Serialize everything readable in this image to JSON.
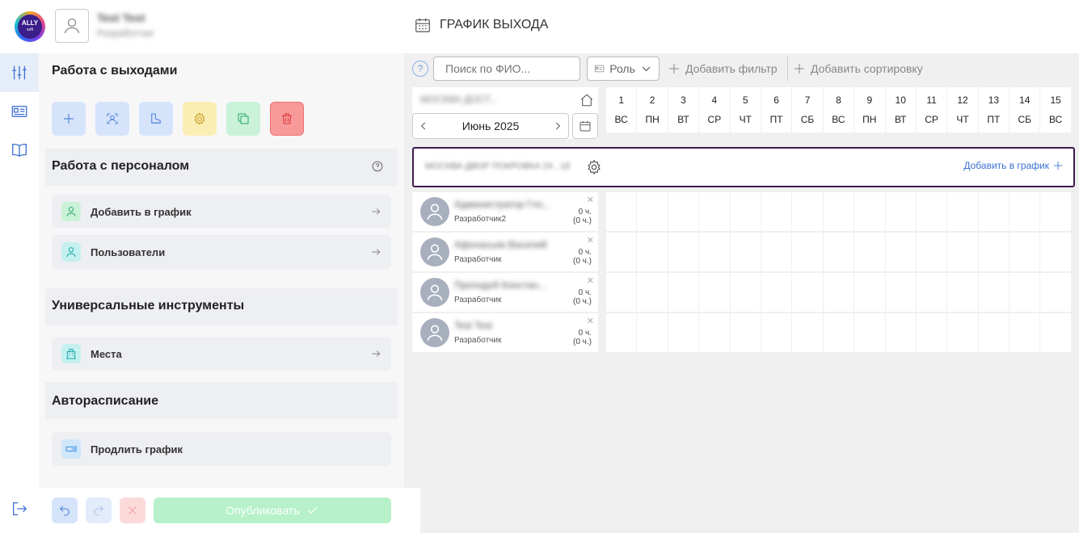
{
  "header": {
    "logo_text": "ALLY",
    "logo_sub": "soft",
    "user_name": "Test Test",
    "user_role": "Разработчик",
    "page_title": "ГРАФИК ВЫХОДА"
  },
  "panel": {
    "sections": {
      "exits": "Работа с выходами",
      "staff": "Работа с персоналом",
      "tools": "Универсальные инструменты",
      "auto": "Авторасписание"
    },
    "cards": {
      "add_to_schedule": "Добавить в график",
      "users": "Пользователи",
      "places": "Места",
      "extend": "Продлить график"
    },
    "publish_label": "Опубликовать"
  },
  "filters": {
    "help": "?",
    "search_placeholder": "Поиск по ФИО...",
    "role_label": "Роль",
    "add_filter": "Добавить фильтр",
    "add_sort": "Добавить сортировку"
  },
  "calendar": {
    "branch_name": "МОСКВА ДОСТ...",
    "month_label": "Июнь 2025",
    "days": [
      {
        "n": "1",
        "w": "ВС"
      },
      {
        "n": "2",
        "w": "ПН"
      },
      {
        "n": "3",
        "w": "ВТ"
      },
      {
        "n": "4",
        "w": "СР"
      },
      {
        "n": "5",
        "w": "ЧТ"
      },
      {
        "n": "6",
        "w": "ПТ"
      },
      {
        "n": "7",
        "w": "СБ"
      },
      {
        "n": "8",
        "w": "ВС"
      },
      {
        "n": "9",
        "w": "ПН"
      },
      {
        "n": "10",
        "w": "ВТ"
      },
      {
        "n": "11",
        "w": "СР"
      },
      {
        "n": "12",
        "w": "ЧТ"
      },
      {
        "n": "13",
        "w": "ПТ"
      },
      {
        "n": "14",
        "w": "СБ"
      },
      {
        "n": "15",
        "w": "ВС"
      }
    ]
  },
  "group": {
    "name": "МОСКВА ДВОР ПОКРОВКА 24 , 18",
    "add_link": "Добавить в график"
  },
  "employees": [
    {
      "name": "Администратор Гло...",
      "role": "Разработчик2",
      "hours": "0 ч.",
      "hours_total": "(0 ч.)"
    },
    {
      "name": "Афонасьев Василий",
      "role": "Разработчик",
      "hours": "0 ч.",
      "hours_total": "(0 ч.)"
    },
    {
      "name": "Преподоб Констан...",
      "role": "Разработчик",
      "hours": "0 ч.",
      "hours_total": "(0 ч.)"
    },
    {
      "name": "Test Test",
      "role": "Разработчик",
      "hours": "0 ч.",
      "hours_total": "(0 ч.)"
    }
  ]
}
